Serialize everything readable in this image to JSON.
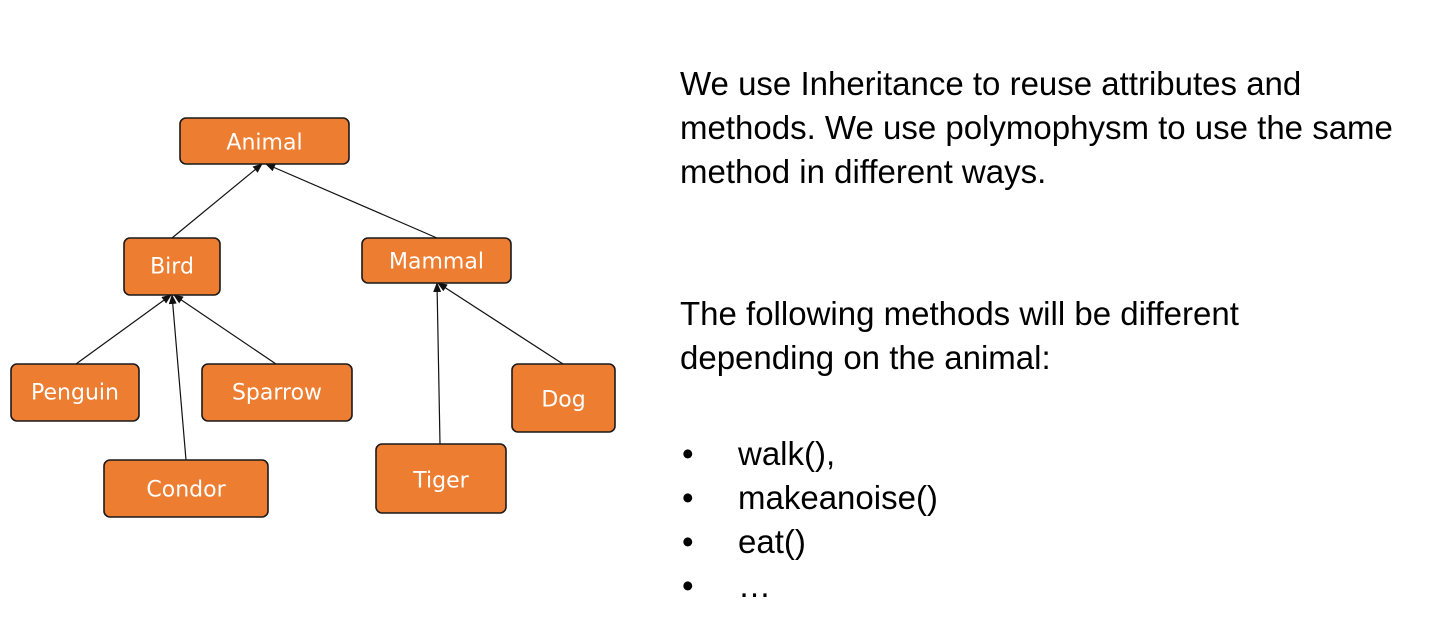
{
  "diagram": {
    "colors": {
      "node_fill": "#ED7D31",
      "node_text": "#FFFFFF",
      "node_border": "#1A1A1A",
      "edge": "#111111"
    },
    "nodes": {
      "animal": "Animal",
      "bird": "Bird",
      "mammal": "Mammal",
      "penguin": "Penguin",
      "sparrow": "Sparrow",
      "condor": "Condor",
      "tiger": "Tiger",
      "dog": "Dog"
    },
    "edges": [
      {
        "from": "bird",
        "to": "animal"
      },
      {
        "from": "mammal",
        "to": "animal"
      },
      {
        "from": "penguin",
        "to": "bird"
      },
      {
        "from": "sparrow",
        "to": "bird"
      },
      {
        "from": "condor",
        "to": "bird"
      },
      {
        "from": "tiger",
        "to": "mammal"
      },
      {
        "from": "dog",
        "to": "mammal"
      }
    ]
  },
  "text": {
    "paragraph1": "We use Inheritance to reuse attributes and methods. We use polymophysm to use the same method in different ways.",
    "paragraph2": "The following methods will be different depending on the animal:",
    "bullet_symbol": "•",
    "methods": [
      "walk(),",
      "makeanoise()",
      "eat()",
      "…"
    ]
  }
}
